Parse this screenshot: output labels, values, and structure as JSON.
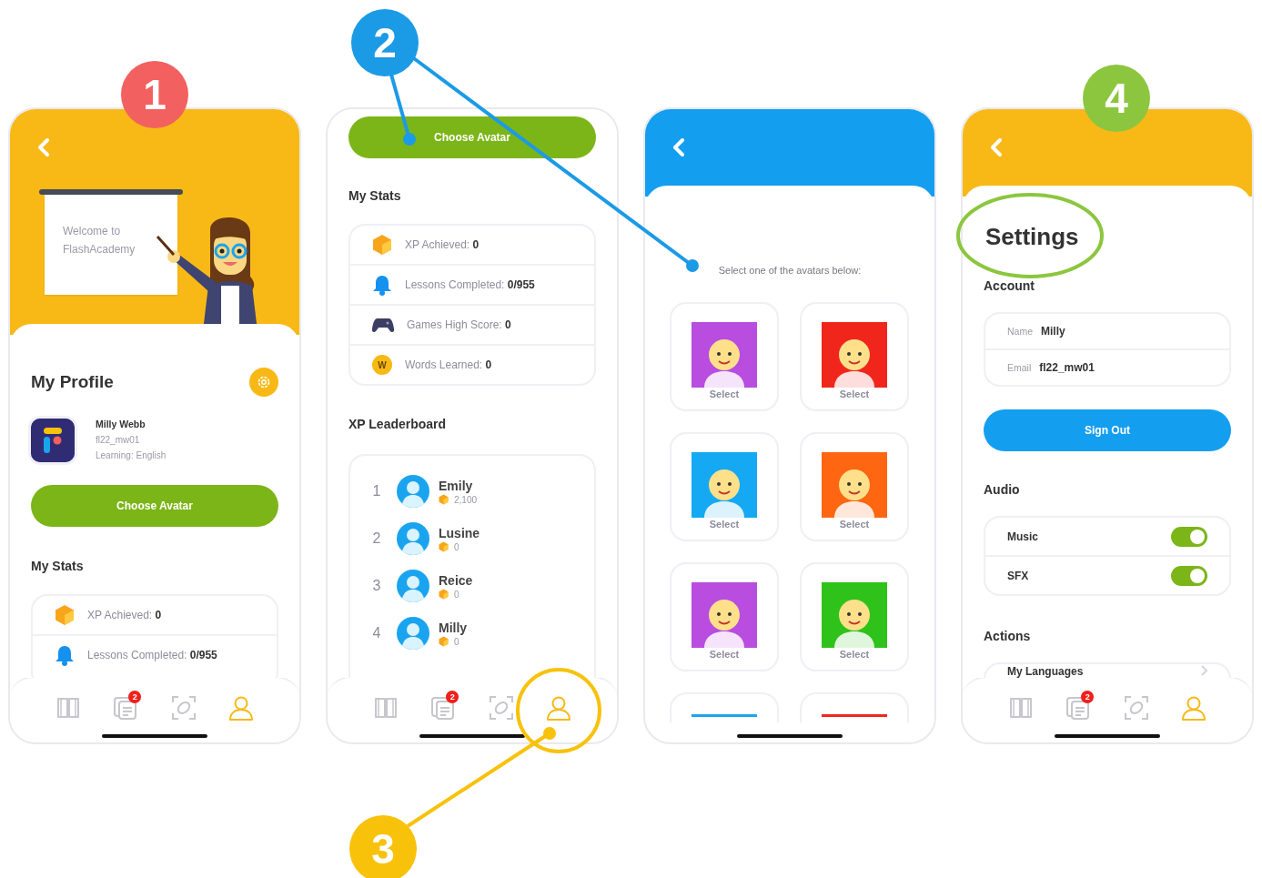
{
  "annotations": [
    {
      "label": "1",
      "color": "#f26060"
    },
    {
      "label": "2",
      "color": "#1b9ae6"
    },
    {
      "label": "3",
      "color": "#f8c20a"
    },
    {
      "label": "4",
      "color": "#8cc63f"
    }
  ],
  "screens": [
    {
      "kind": "profile",
      "board_text": "Welcome to FlashAcademy",
      "title": "My Profile",
      "user": {
        "name": "Milly Webb",
        "username": "fl22_mw01",
        "learning": "Learning: English"
      },
      "button": "Choose Avatar",
      "stats_title": "My Stats",
      "stats": [
        {
          "kind": "xp",
          "text": "XP Achieved: **0**"
        },
        {
          "kind": "lessons",
          "text": "Lessons Completed: **0/955**"
        }
      ],
      "nav": [
        {
          "kind": "book",
          "selected": false
        },
        {
          "kind": "notes",
          "selected": false,
          "badge": "2"
        },
        {
          "kind": "scan",
          "selected": false
        },
        {
          "kind": "profile",
          "selected": true
        }
      ]
    },
    {
      "kind": "stats",
      "button": "Choose Avatar",
      "stats_title": "My Stats",
      "stats": [
        {
          "kind": "xp",
          "text": "XP Achieved: **0**"
        },
        {
          "kind": "lessons",
          "text": "Lessons Completed: **0/955**"
        },
        {
          "kind": "games",
          "text": "Games High Score: **0**"
        },
        {
          "kind": "words",
          "icon_text": "W",
          "text": "Words Learned: **0**"
        }
      ],
      "leaderboard_title": "XP Leaderboard",
      "leaderboard": [
        {
          "rank": "1",
          "name": "Emily",
          "xp": "2,100"
        },
        {
          "rank": "2",
          "name": "Lusine",
          "xp": "0"
        },
        {
          "rank": "3",
          "name": "Reice",
          "xp": "0"
        },
        {
          "rank": "4",
          "name": "Milly",
          "xp": "0"
        }
      ],
      "nav": [
        {
          "kind": "book",
          "selected": false
        },
        {
          "kind": "notes",
          "selected": false,
          "badge": "2"
        },
        {
          "kind": "scan",
          "selected": false
        },
        {
          "kind": "profile",
          "selected": true
        }
      ]
    },
    {
      "kind": "avatars",
      "prompt": "Select one of the avatars below:",
      "avatars": [
        {
          "kind": "tile",
          "color": "#b84de0",
          "label": "Select"
        },
        {
          "kind": "tile",
          "color": "#f0261d",
          "label": "Select"
        },
        {
          "kind": "tile",
          "color": "#14a9f2",
          "label": "Select"
        },
        {
          "kind": "tile",
          "color": "#ff6611",
          "label": "Select"
        },
        {
          "kind": "tile",
          "color": "#b84de0",
          "label": "Select"
        },
        {
          "kind": "tile",
          "color": "#2fc21a",
          "label": "Select"
        },
        {
          "kind": "cut",
          "color": "#1aa6ef"
        },
        {
          "kind": "cut",
          "color": "#f0261d"
        }
      ]
    },
    {
      "kind": "settings",
      "title": "Settings",
      "account_title": "Account",
      "account": [
        {
          "label": "Name",
          "value": "Milly"
        },
        {
          "label": "Email",
          "value": "fl22_mw01"
        }
      ],
      "button": "Sign Out",
      "audio_title": "Audio",
      "audio": [
        {
          "label": "Music",
          "on": true
        },
        {
          "label": "SFX",
          "on": true
        }
      ],
      "actions_title": "Actions",
      "actions": [
        {
          "label": "My Languages"
        }
      ],
      "nav": [
        {
          "kind": "book",
          "selected": false
        },
        {
          "kind": "notes",
          "selected": false,
          "badge": "2"
        },
        {
          "kind": "scan",
          "selected": false
        },
        {
          "kind": "profile",
          "selected": true
        }
      ]
    }
  ]
}
